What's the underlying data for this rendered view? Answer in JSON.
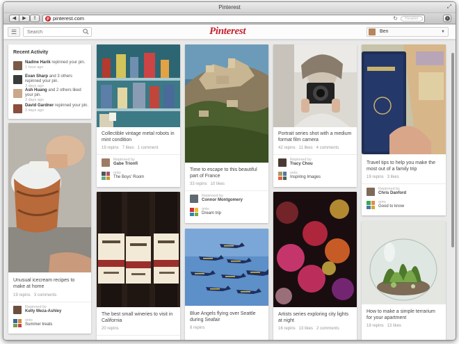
{
  "window": {
    "title": "Pinterest"
  },
  "browser": {
    "url": "pinterest.com",
    "reader_label": "Reader"
  },
  "header": {
    "search_placeholder": "Search",
    "logo": "Pinterest",
    "username": "Ben"
  },
  "activity": {
    "title": "Recent Activity",
    "items": [
      {
        "name": "Nadine Harik",
        "action": "repinned your pin.",
        "time": "1 hour ago"
      },
      {
        "name": "Evan Sharp",
        "action": "and 3 others repinned your pin.",
        "time": "3 days ago"
      },
      {
        "name": "Ash Huang",
        "action": "and 2 others liked your pin.",
        "time": "3 days ago"
      },
      {
        "name": "David Gardner",
        "action": "repinned your pin.",
        "time": "3 days ago"
      }
    ]
  },
  "pins": [
    {
      "caption": "Unusual icecream recipes to make at home",
      "repins": "19 repins",
      "likes": "",
      "comments": "3 comments",
      "via_label": "Repinned by",
      "via_name": "Kelly Meza-Ashley",
      "onto_label": "onto",
      "board": "Summer treats"
    },
    {
      "caption": "Collectible vintage metal robots in mint condition",
      "repins": "19 repins",
      "likes": "7 likes",
      "comments": "1 comment",
      "via_label": "Repinned by",
      "via_name": "Gabe Trionfi",
      "onto_label": "onto",
      "board": "The Boys' Room"
    },
    {
      "caption": "The best small wineries to visit in California",
      "repins": "20 repins",
      "likes": "",
      "comments": ""
    },
    {
      "caption": "Time to escape to this beautiful part of France",
      "repins": "33 repins",
      "likes": "10 likes",
      "comments": "",
      "via_label": "Repinned by",
      "via_name": "Connor Montgomery",
      "onto_label": "onto",
      "board": "Dream trip"
    },
    {
      "caption": "Blue Angels flying over Seattle during Seafair",
      "repins": "8 repins",
      "likes": "",
      "comments": ""
    },
    {
      "caption": "Portrait series shot with a medium format film camera",
      "repins": "42 repins",
      "likes": "11 likes",
      "comments": "4 comments",
      "via_label": "Repinned by",
      "via_name": "Tracy Chou",
      "onto_label": "onto",
      "board": "Inspiring Images"
    },
    {
      "caption": "Artists series exploring city lights at night",
      "repins": "16 repins",
      "likes": "13 likes",
      "comments": "2 comments"
    },
    {
      "caption": "Travel tips to help you make the most out of a family trip",
      "repins": "19 repins",
      "likes": "3 likes",
      "comments": "",
      "via_label": "Repinned by",
      "via_name": "Chris Danford",
      "onto_label": "onto",
      "board": "Good to know"
    },
    {
      "caption": "How to make a simple terrarium for your apartment",
      "repins": "18 repins",
      "likes": "13 likes",
      "comments": ""
    }
  ]
}
